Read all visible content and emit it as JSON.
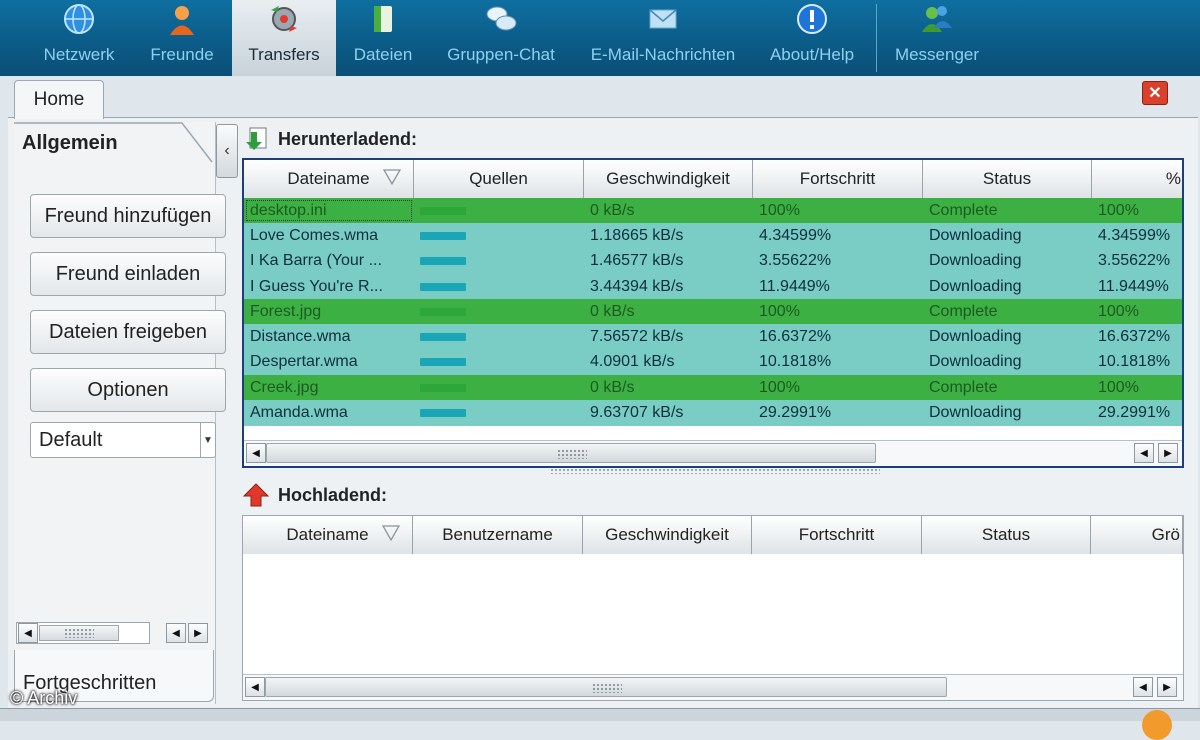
{
  "toolbar": {
    "items": [
      {
        "label": "Netzwerk",
        "icon": "globe-icon"
      },
      {
        "label": "Freunde",
        "icon": "person-icon"
      },
      {
        "label": "Transfers",
        "icon": "transfers-icon"
      },
      {
        "label": "Dateien",
        "icon": "document-icon"
      },
      {
        "label": "Gruppen-Chat",
        "icon": "chat-bubbles-icon"
      },
      {
        "label": "E-Mail-Nachrichten",
        "icon": "email-icon"
      },
      {
        "label": "About/Help",
        "icon": "info-icon"
      },
      {
        "label": "Messenger",
        "icon": "messenger-people-icon"
      }
    ],
    "active": "Transfers"
  },
  "home_tab": {
    "label": "Home"
  },
  "sidebar": {
    "tab_label": "Allgemein",
    "buttons": [
      "Freund hinzufügen",
      "Freund einladen",
      "Dateien freigeben",
      "Optionen"
    ],
    "select_value": "Default",
    "bottom_tab_label": "Fortgeschritten"
  },
  "downloads": {
    "title": "Herunterladend:",
    "columns": [
      "Dateiname",
      "Quellen",
      "Geschwindigkeit",
      "Fortschritt",
      "Status",
      "%"
    ],
    "rows": [
      {
        "name": "desktop.ini",
        "speed": "0 kB/s",
        "progress": "100%",
        "status": "Complete",
        "pct": "100%"
      },
      {
        "name": "Love Comes.wma",
        "speed": "1.18665 kB/s",
        "progress": "4.34599%",
        "status": "Downloading",
        "pct": "4.34599%"
      },
      {
        "name": "I Ka Barra (Your ...",
        "speed": "1.46577 kB/s",
        "progress": "3.55622%",
        "status": "Downloading",
        "pct": "3.55622%"
      },
      {
        "name": "I Guess You're R...",
        "speed": "3.44394 kB/s",
        "progress": "11.9449%",
        "status": "Downloading",
        "pct": "11.9449%"
      },
      {
        "name": "Forest.jpg",
        "speed": "0 kB/s",
        "progress": "100%",
        "status": "Complete",
        "pct": "100%"
      },
      {
        "name": "Distance.wma",
        "speed": "7.56572 kB/s",
        "progress": "16.6372%",
        "status": "Downloading",
        "pct": "16.6372%"
      },
      {
        "name": "Despertar.wma",
        "speed": "4.0901 kB/s",
        "progress": "10.1818%",
        "status": "Downloading",
        "pct": "10.1818%"
      },
      {
        "name": "Creek.jpg",
        "speed": "0 kB/s",
        "progress": "100%",
        "status": "Complete",
        "pct": "100%"
      },
      {
        "name": "Amanda.wma",
        "speed": "9.63707 kB/s",
        "progress": "29.2991%",
        "status": "Downloading",
        "pct": "29.2991%"
      }
    ]
  },
  "uploads": {
    "title": "Hochladend:",
    "columns": [
      "Dateiname",
      "Benutzername",
      "Geschwindigkeit",
      "Fortschritt",
      "Status",
      "Grö"
    ]
  },
  "watermark": "© Archiv",
  "colors": {
    "complete": "#3cb043",
    "downloading": "#79cdc4",
    "toolbar": "#0b5a86",
    "grid_border": "#1b3f7a"
  }
}
